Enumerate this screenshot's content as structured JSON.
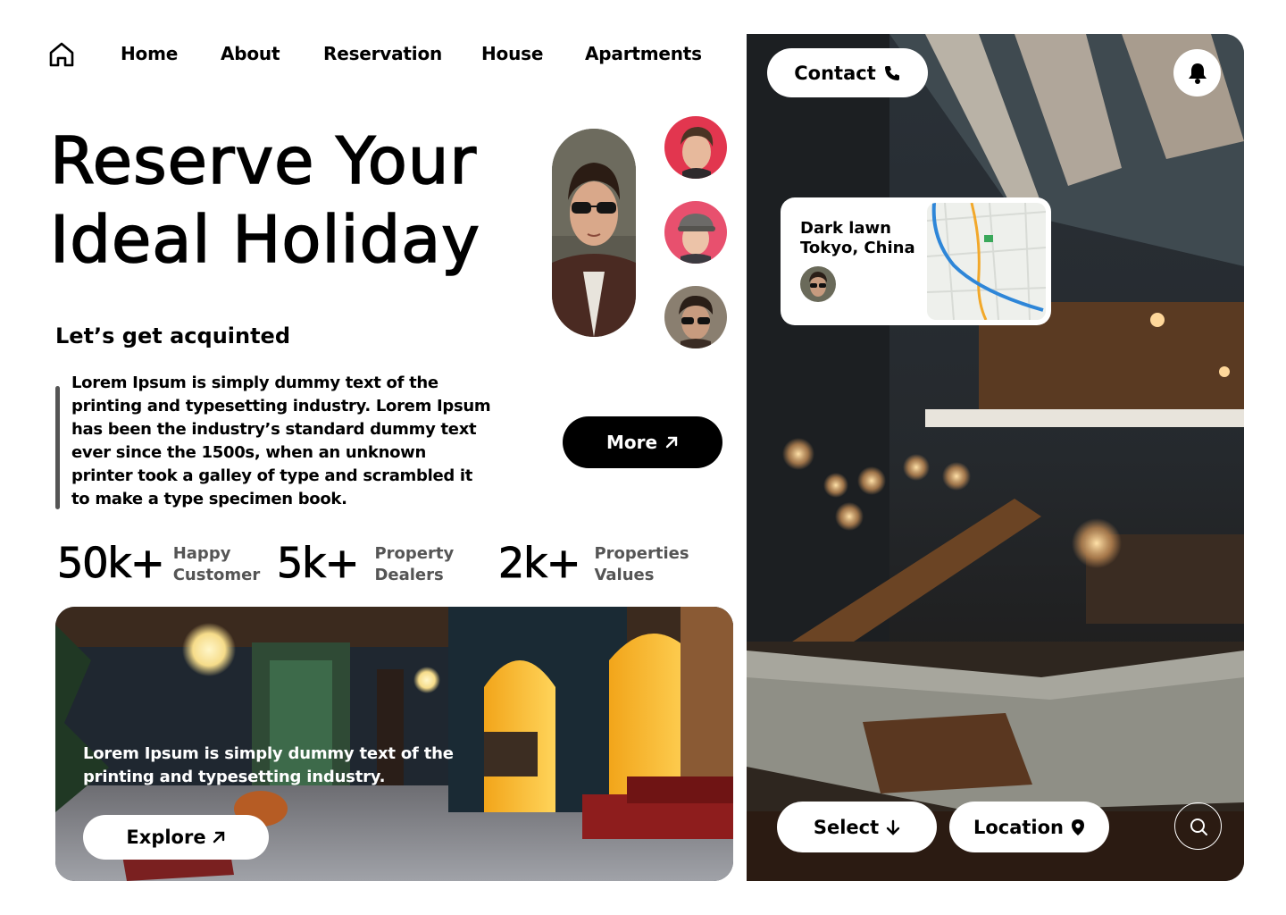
{
  "nav": {
    "home_icon": "home-icon",
    "links": [
      "Home",
      "About",
      "Reservation",
      "House",
      "Apartments"
    ]
  },
  "hero": {
    "title_line1": "Reserve Your",
    "title_line2": "Ideal Holiday"
  },
  "intro": {
    "heading": "Let’s get acquinted",
    "body": "Lorem Ipsum is simply dummy text of the printing and typesetting industry. Lorem Ipsum has been the industry’s standard dummy text ever since the 1500s, when an unknown printer took a galley of type and scrambled it to make a type specimen book.",
    "more_label": "More",
    "more_icon": "arrow-up-right-icon"
  },
  "stats": [
    {
      "value": "50k+",
      "label": "Happy\nCustomer"
    },
    {
      "value": "5k+",
      "label": "Property\nDealers"
    },
    {
      "value": "2k+",
      "label": "Properties\nValues"
    }
  ],
  "promo": {
    "text": "Lorem Ipsum is simply dummy text of the printing and typesetting industry.",
    "explore_label": "Explore",
    "explore_icon": "arrow-up-right-icon"
  },
  "panel": {
    "contact_label": "Contact",
    "contact_icon": "phone-icon",
    "bell_icon": "bell-icon",
    "map_card": {
      "title": "Dark lawn\nTokyo, China"
    },
    "select_label": "Select",
    "select_icon": "arrow-down-icon",
    "location_label": "Location",
    "location_icon": "map-pin-icon",
    "search_icon": "search-icon"
  },
  "colors": {
    "primary": "#000000",
    "background": "#ffffff",
    "muted_text": "#555555",
    "avatar_red": "#e2364f",
    "avatar_pink": "#e8506e"
  }
}
